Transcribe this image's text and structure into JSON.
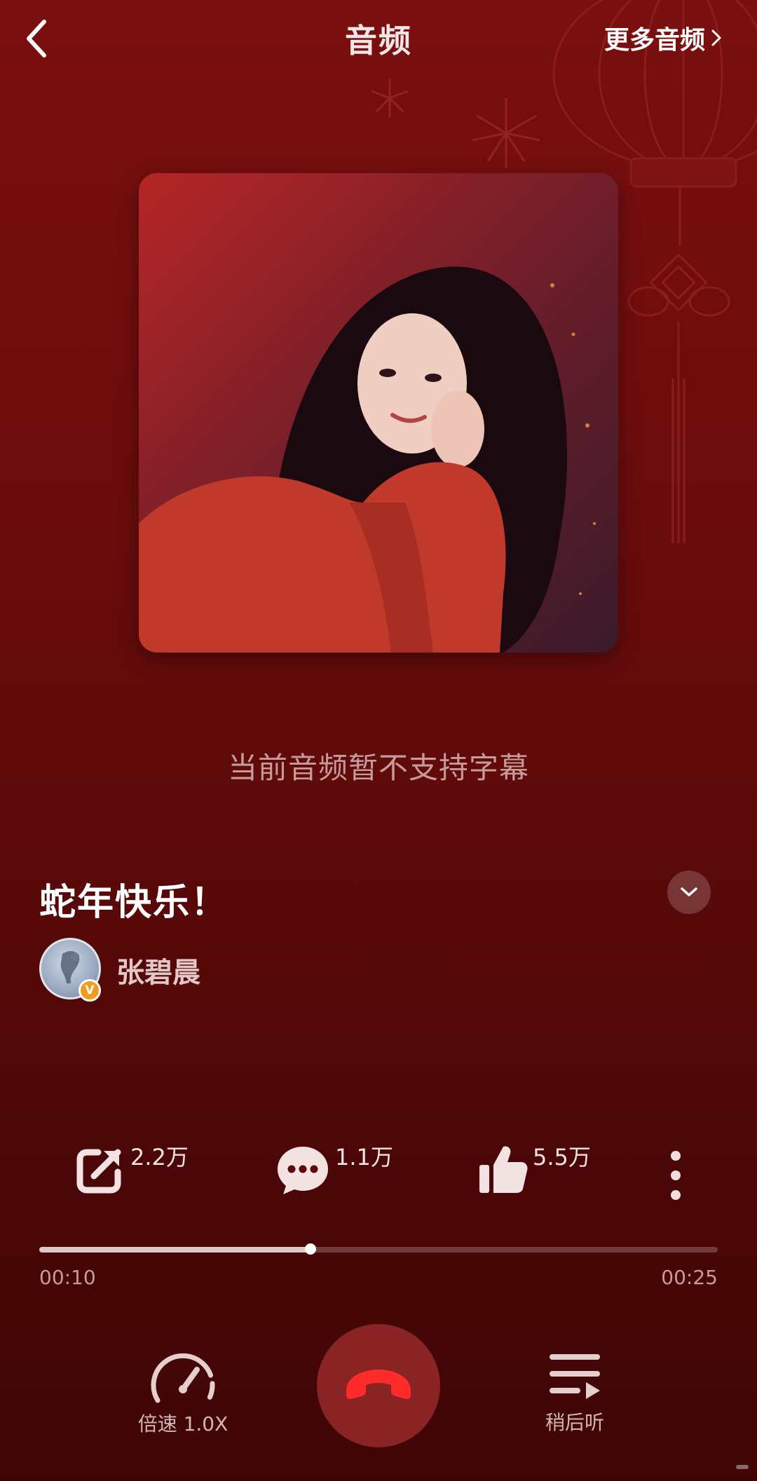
{
  "header": {
    "title": "音频",
    "more_label": "更多音频",
    "back_icon": "chevron-left-icon",
    "more_icon": "chevron-right-icon"
  },
  "cover": {
    "icon": "album-cover-image"
  },
  "subtitle_notice": "当前音频暂不支持字幕",
  "track": {
    "title": "蛇年快乐！",
    "author": "张碧晨",
    "verified_badge": "V"
  },
  "actions": {
    "share_count": "2.2万",
    "comment_count": "1.1万",
    "like_count": "5.5万"
  },
  "progress": {
    "current": "00:10",
    "total": "00:25",
    "fraction": 0.4
  },
  "controls": {
    "speed_label": "倍速 1.0X",
    "later_label": "稍后听"
  },
  "colors": {
    "background": "#6d0c0c",
    "hangup_button": "#8a2323",
    "hangup_icon": "#ff2a2a",
    "verified_badge": "#f39b1d"
  }
}
